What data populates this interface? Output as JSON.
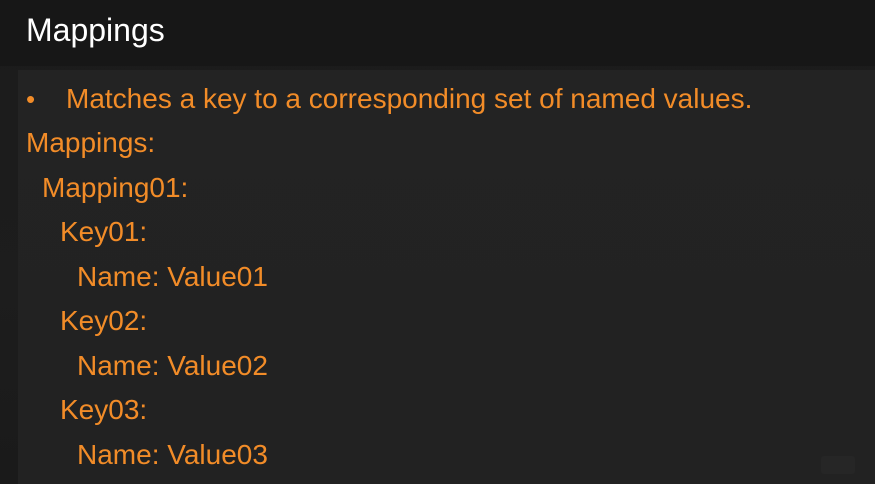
{
  "slide": {
    "title": "Mappings",
    "bullet_symbol": "•",
    "bullet_text": "Matches a key to a corresponding set of named values.",
    "code_lines": [
      "Mappings:",
      "Mapping01:",
      "Key01:",
      "Name: Value01",
      "Key02:",
      "Name: Value02",
      "Key03:",
      "Name: Value03"
    ]
  },
  "colors": {
    "background": "#1a1a1a",
    "title_text": "#ffffff",
    "accent_text": "#f28c28"
  }
}
